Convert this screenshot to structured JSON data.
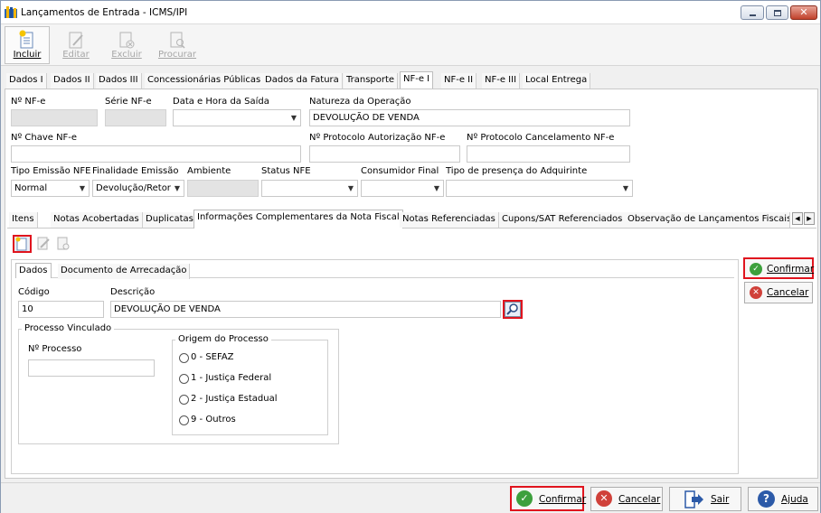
{
  "window": {
    "title": "Lançamentos de Entrada - ICMS/IPI"
  },
  "toolbar": {
    "incluir": "Incluir",
    "editar": "Editar",
    "excluir": "Excluir",
    "procurar": "Procurar"
  },
  "main_tabs": [
    "Dados I",
    "Dados II",
    "Dados III",
    "Concessionárias Públicas",
    "Dados da Fatura",
    "Transporte",
    "NF-e I",
    "NF-e II",
    "NF-e III",
    "Local Entrega"
  ],
  "nfe": {
    "num_label": "Nº NF-e",
    "num_value": "",
    "serie_label": "Série NF-e",
    "serie_value": "",
    "data_label": "Data e Hora da Saída",
    "data_value": "",
    "natureza_label": "Natureza da Operação",
    "natureza_value": "DEVOLUÇÃO DE VENDA",
    "chave_label": "Nº Chave NF-e",
    "chave_value": "",
    "protocolo_aut_label": "Nº Protocolo Autorização NF-e",
    "protocolo_aut_value": "",
    "protocolo_canc_label": "Nº Protocolo Cancelamento NF-e",
    "protocolo_canc_value": "",
    "tipo_emissao_label": "Tipo Emissão NFE",
    "tipo_emissao_value": "Normal",
    "finalidade_label": "Finalidade Emissão",
    "finalidade_value": "Devolução/Retor",
    "ambiente_label": "Ambiente",
    "ambiente_value": "",
    "status_label": "Status NFE",
    "status_value": "",
    "consumidor_label": "Consumidor Final",
    "consumidor_value": "",
    "presenca_label": "Tipo de presença do Adquirinte",
    "presenca_value": ""
  },
  "sub_tabs": [
    "Itens",
    "Notas Acobertadas",
    "Duplicatas",
    "Informações Complementares da Nota Fiscal",
    "Notas Referenciadas",
    "Cupons/SAT Referenciados",
    "Observação de Lançamentos Fiscais (C"
  ],
  "detail": {
    "tabs": [
      "Dados",
      "Documento de Arrecadação"
    ],
    "codigo_label": "Código",
    "codigo_value": "10",
    "descricao_label": "Descrição",
    "descricao_value": "DEVOLUÇÃO DE VENDA",
    "processo_title": "Processo Vinculado",
    "nprocesso_label": "Nº Processo",
    "nprocesso_value": "",
    "origem_title": "Origem do Processo",
    "origem_options": [
      "0 - SEFAZ",
      "1 - Justiça Federal",
      "2 - Justiça Estadual",
      "9 - Outros"
    ]
  },
  "side_buttons": {
    "confirmar": "Confirmar",
    "cancelar": "Cancelar"
  },
  "bottom_buttons": {
    "confirmar": "Confirmar",
    "cancelar": "Cancelar",
    "sair": "Sair",
    "ajuda": "Ajuda"
  },
  "colors": {
    "highlight": "#e0141e",
    "confirm_green": "#3da03d",
    "cancel_red": "#d0413a",
    "help_blue": "#2c5aa8"
  }
}
